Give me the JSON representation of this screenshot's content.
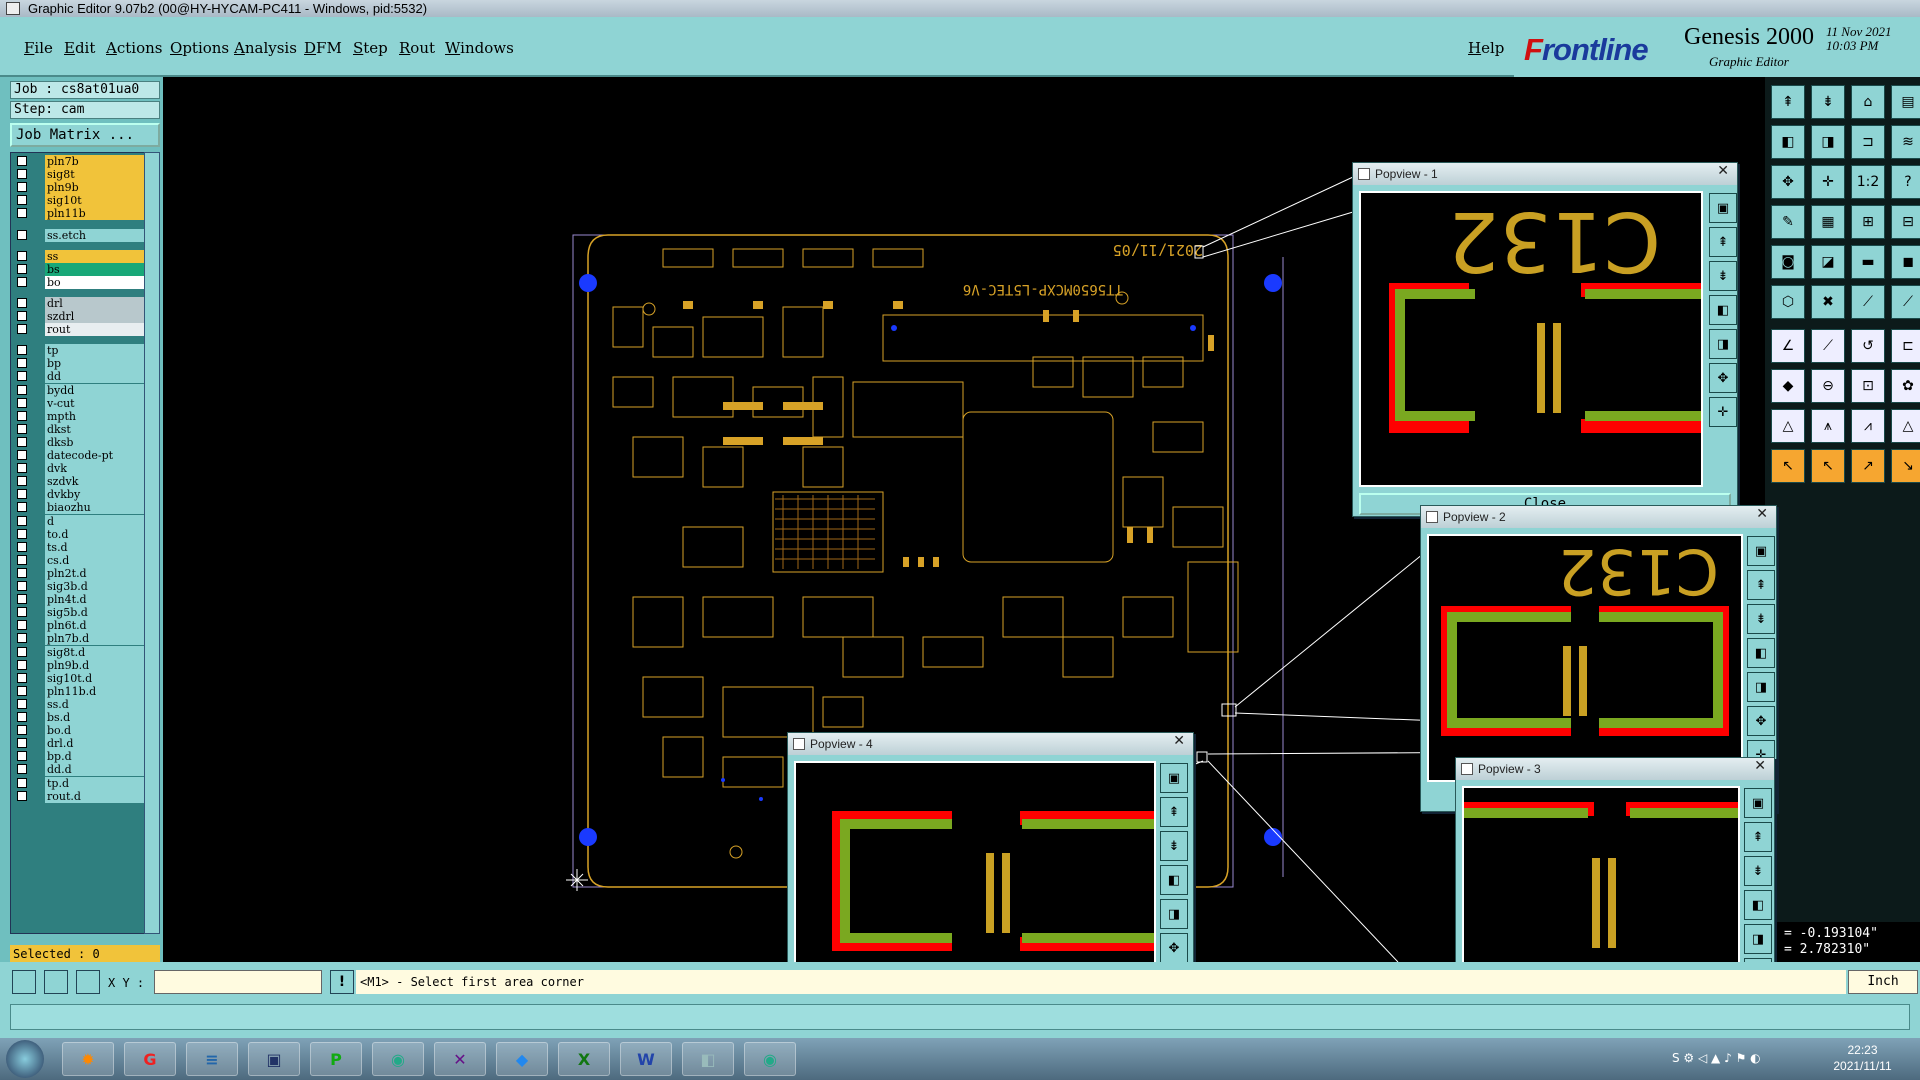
{
  "window": {
    "title": "Graphic Editor 9.07b2 (00@HY-HYCAM-PC411 - Windows, pid:5532)"
  },
  "menu": [
    "File",
    "Edit",
    "Actions",
    "Options",
    "Analysis",
    "DFM",
    "Step",
    "Rout",
    "Windows"
  ],
  "help": "Help",
  "brand": {
    "logo_f": "F",
    "logo_rest": "rontline",
    "product": "Genesis 2000",
    "subtitle": "Graphic Editor",
    "date": "11 Nov 2021\n10:03 PM"
  },
  "job": {
    "job": "Job : cs8at01ua0",
    "step": "Step: cam",
    "matrix": "Job Matrix ..."
  },
  "layers": [
    {
      "name": "pln7b",
      "color": "#f1c33a"
    },
    {
      "name": "sig8t",
      "color": "#f1c33a"
    },
    {
      "name": "pln9b",
      "color": "#f1c33a"
    },
    {
      "name": "sig10t",
      "color": "#f1c33a"
    },
    {
      "name": "pln11b",
      "color": "#f1c33a"
    },
    {
      "name": "ss.etch",
      "color": "#8fd4d4"
    },
    {
      "name": "ss",
      "color": "#f1c33a"
    },
    {
      "name": "bs",
      "color": "#18a878"
    },
    {
      "name": "bo",
      "color": "#ffffff"
    },
    {
      "name": "drl",
      "color": "#b8c8cc"
    },
    {
      "name": "szdrl",
      "color": "#b8c8cc"
    },
    {
      "name": "rout",
      "color": "#e8eef0"
    },
    {
      "name": "tp",
      "color": "#8fd4d4"
    },
    {
      "name": "bp",
      "color": "#8fd4d4"
    },
    {
      "name": "dd",
      "color": "#8fd4d4"
    },
    {
      "name": "bydd",
      "color": "#8fd4d4"
    },
    {
      "name": "v-cut",
      "color": "#8fd4d4"
    },
    {
      "name": "mpth",
      "color": "#8fd4d4"
    },
    {
      "name": "dkst",
      "color": "#8fd4d4"
    },
    {
      "name": "dksb",
      "color": "#8fd4d4"
    },
    {
      "name": "datecode-pt",
      "color": "#8fd4d4"
    },
    {
      "name": "dvk",
      "color": "#8fd4d4"
    },
    {
      "name": "szdvk",
      "color": "#8fd4d4"
    },
    {
      "name": "dvkby",
      "color": "#8fd4d4"
    },
    {
      "name": "biaozhu",
      "color": "#8fd4d4"
    },
    {
      "name": "d",
      "color": "#8fd4d4"
    },
    {
      "name": "to.d",
      "color": "#8fd4d4"
    },
    {
      "name": "ts.d",
      "color": "#8fd4d4"
    },
    {
      "name": "cs.d",
      "color": "#8fd4d4"
    },
    {
      "name": "pln2t.d",
      "color": "#8fd4d4"
    },
    {
      "name": "sig3b.d",
      "color": "#8fd4d4"
    },
    {
      "name": "pln4t.d",
      "color": "#8fd4d4"
    },
    {
      "name": "sig5b.d",
      "color": "#8fd4d4"
    },
    {
      "name": "pln6t.d",
      "color": "#8fd4d4"
    },
    {
      "name": "pln7b.d",
      "color": "#8fd4d4"
    },
    {
      "name": "sig8t.d",
      "color": "#8fd4d4"
    },
    {
      "name": "pln9b.d",
      "color": "#8fd4d4"
    },
    {
      "name": "sig10t.d",
      "color": "#8fd4d4"
    },
    {
      "name": "pln11b.d",
      "color": "#8fd4d4"
    },
    {
      "name": "ss.d",
      "color": "#8fd4d4"
    },
    {
      "name": "bs.d",
      "color": "#8fd4d4"
    },
    {
      "name": "bo.d",
      "color": "#8fd4d4"
    },
    {
      "name": "drl.d",
      "color": "#8fd4d4"
    },
    {
      "name": "bp.d",
      "color": "#8fd4d4"
    },
    {
      "name": "dd.d",
      "color": "#8fd4d4"
    },
    {
      "name": "tp.d",
      "color": "#8fd4d4"
    },
    {
      "name": "rout.d",
      "color": "#8fd4d4"
    }
  ],
  "selected": "Selected : 0",
  "board": {
    "datecode": "2021/11/05",
    "part": "TT5650MCXP-L5TEC-V6"
  },
  "popviews": {
    "p1": "Popview - 1",
    "p2": "Popview - 2",
    "p3": "Popview - 3",
    "p4": "Popview - 4",
    "zoom_text": "C132",
    "close": "Close"
  },
  "bottom": {
    "xy_label": "X Y :",
    "prompt": "<M1> - Select first area corner",
    "units": "Inch",
    "coords": "= -0.193104\"\n= 2.782310\""
  },
  "taskbar": {
    "time": "22:23",
    "date": "2021/11/11"
  },
  "colors": {
    "panel": "#8fd4d4",
    "signal": "#f1c33a",
    "bs": "#18a878",
    "red": "#ff0000",
    "green": "#7aa820"
  }
}
